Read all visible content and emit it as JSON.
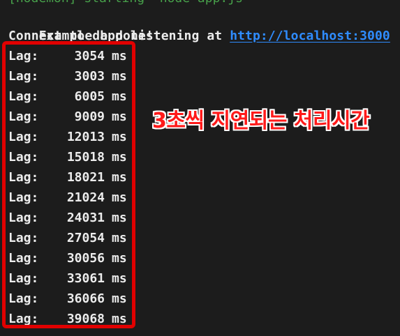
{
  "terminal": {
    "clipped_top_line": "[nodemon] starting `node app.js`",
    "listening_prefix": "Example app listening at ",
    "listening_url": "http://localhost:3000",
    "db_line": "Connect to db done!",
    "lag_label": "Lag:",
    "lag_unit": "ms",
    "lag_values": [
      "3054",
      "3003",
      "6005",
      "9009",
      "12013",
      "15018",
      "18021",
      "21024",
      "24031",
      "27054",
      "30056",
      "33061",
      "36066",
      "39068"
    ]
  },
  "annotation": {
    "text": "3초씩 지연되는 처리시간",
    "color": "#ff1a1a",
    "outline_color": "#ffffff"
  },
  "highlight": {
    "color": "#e10000"
  },
  "colors": {
    "background": "#1c1c1c",
    "text": "#ececec",
    "link": "#2f8cff"
  }
}
